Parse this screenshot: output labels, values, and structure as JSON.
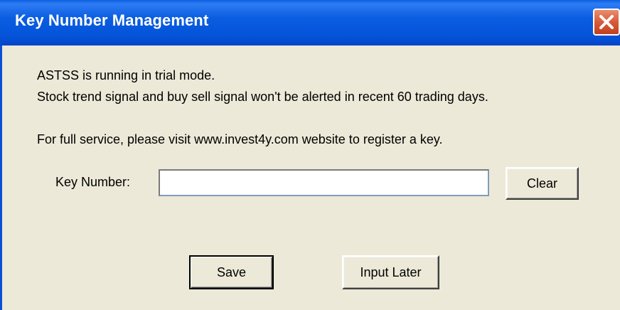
{
  "window": {
    "title": "Key Number Management",
    "close_icon": "close-icon"
  },
  "messages": {
    "line1": "ASTSS is running in trial mode.",
    "line2": "Stock trend signal and buy sell signal won't be alerted  in recent 60 trading days.",
    "line3": "For full service, please visit www.invest4y.com website to register a key."
  },
  "key_field": {
    "label": "Key Number:",
    "value": "",
    "placeholder": ""
  },
  "buttons": {
    "clear": "Clear",
    "save": "Save",
    "input_later": "Input Later"
  },
  "colors": {
    "titlebar": "#0A5DE0",
    "window_bg": "#ECE9D8",
    "close_button": "#D85A3A"
  }
}
